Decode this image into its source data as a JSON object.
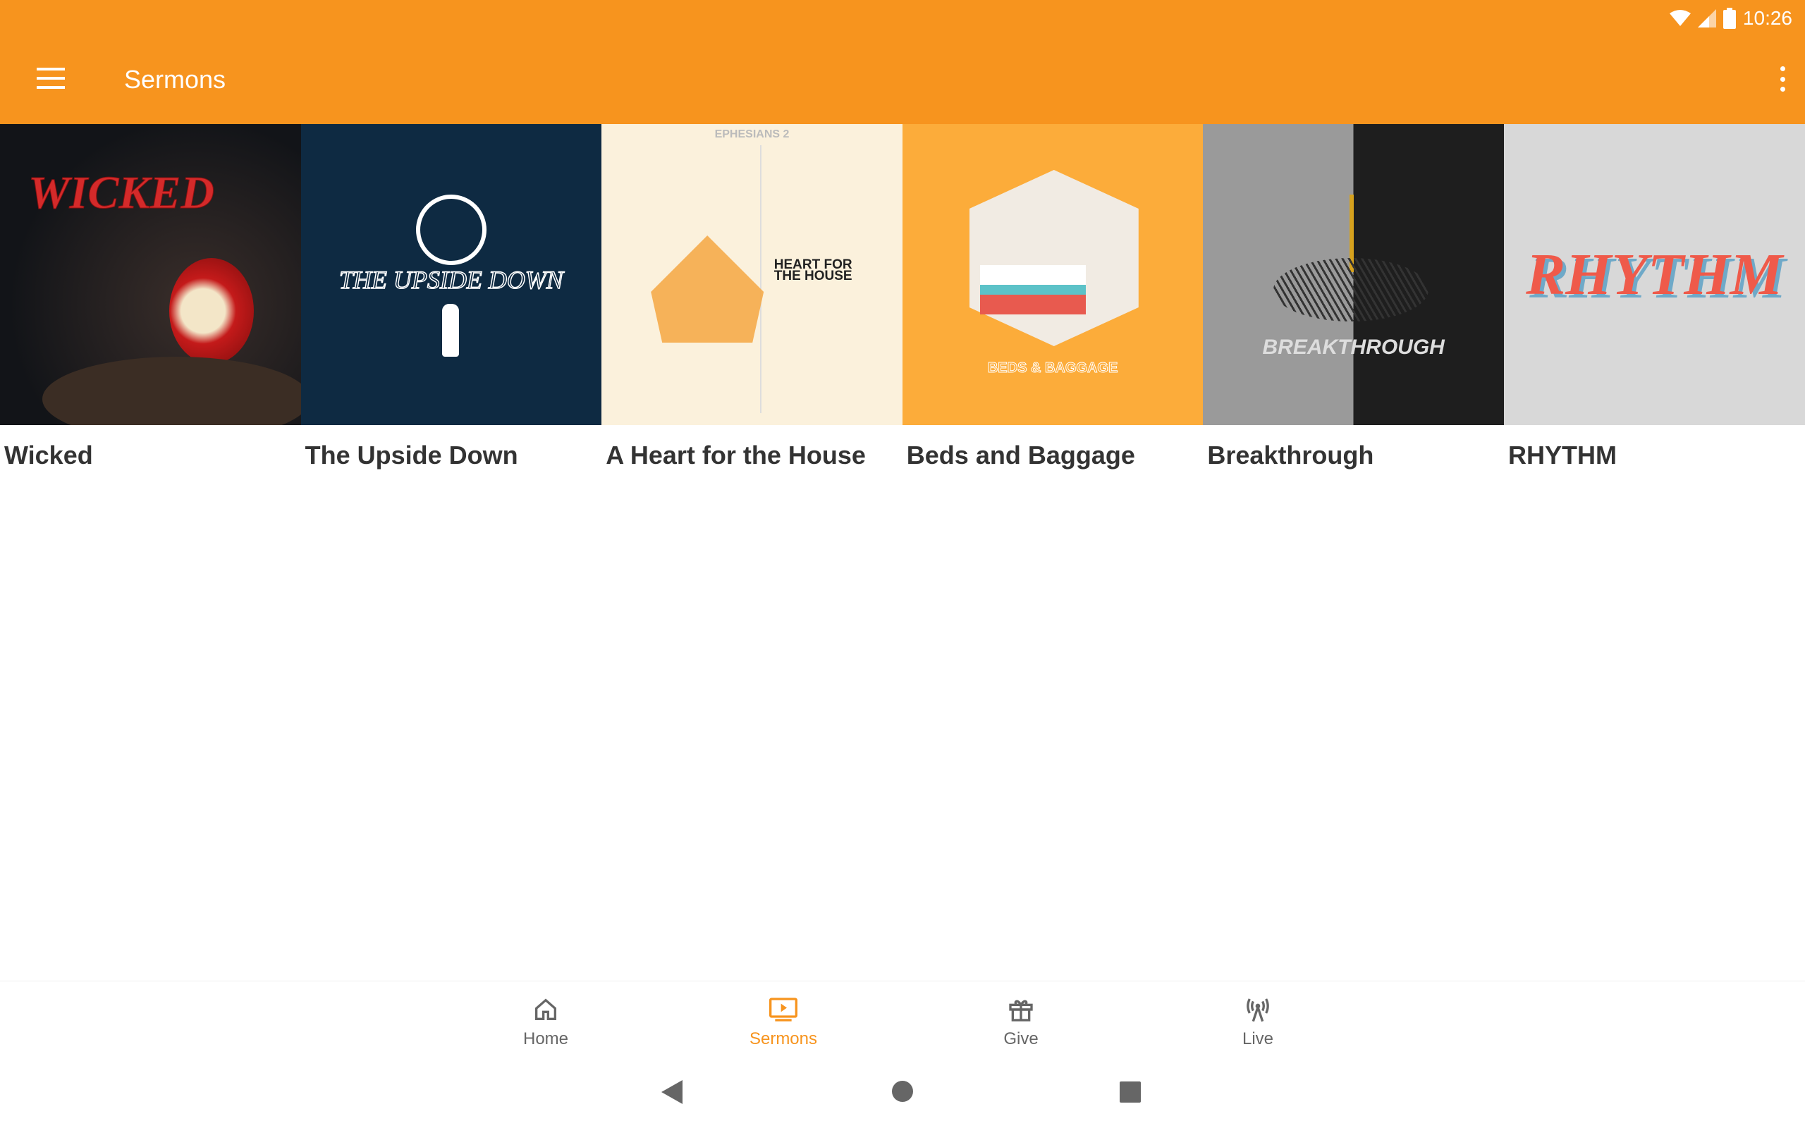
{
  "status": {
    "time": "10:26"
  },
  "appbar": {
    "title": "Sermons",
    "accent": "#f7941e"
  },
  "sermons": [
    {
      "title": "Wicked",
      "art_text": "WICKED"
    },
    {
      "title": "The Upside Down",
      "art_text": "THE UPSIDE DOWN"
    },
    {
      "title": "A Heart for the House",
      "art_text": "HEART FOR THE HOUSE",
      "art_subtext": "EPHESIANS 2"
    },
    {
      "title": "Beds and Baggage",
      "art_text": "BEDS & BAGGAGE"
    },
    {
      "title": "Breakthrough",
      "art_text": "BREAKTHROUGH"
    },
    {
      "title": "RHYTHM",
      "art_text": "RHYTHM"
    }
  ],
  "bottom_nav": [
    {
      "label": "Home",
      "icon": "home-icon"
    },
    {
      "label": "Sermons",
      "icon": "tv-play-icon",
      "active": true
    },
    {
      "label": "Give",
      "icon": "gift-icon"
    },
    {
      "label": "Live",
      "icon": "broadcast-icon"
    }
  ]
}
